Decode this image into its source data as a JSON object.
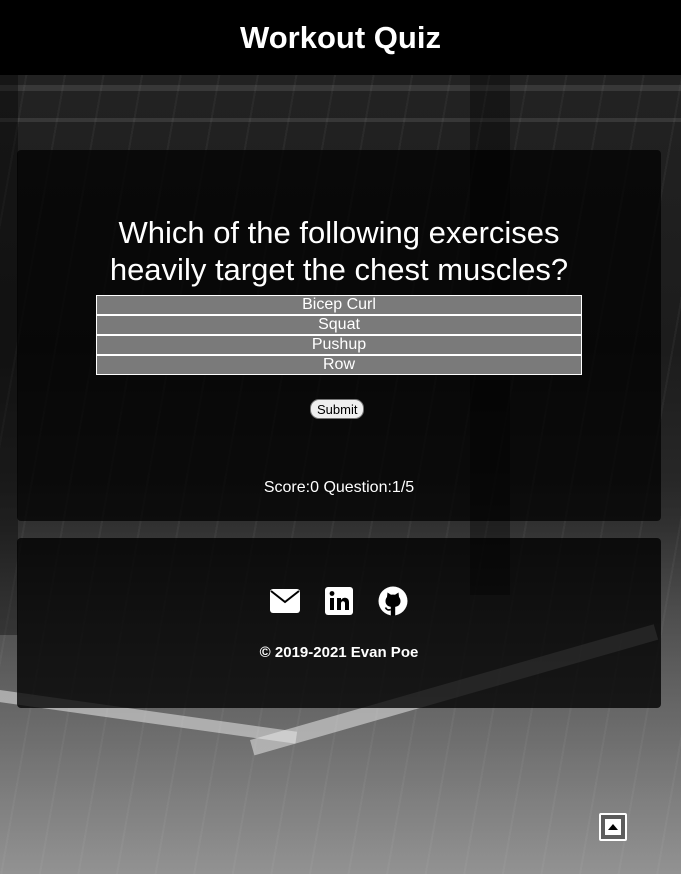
{
  "header": {
    "title": "Workout Quiz"
  },
  "quiz": {
    "question_line1": "Which of the following exercises",
    "question_line2": "heavily target the chest muscles?",
    "choices": [
      "Bicep Curl",
      "Squat",
      "Pushup",
      "Row"
    ],
    "submit_label": "Submit",
    "score_label": "Score:",
    "score": "0",
    "question_label": "Question:",
    "question_progress": "1/5"
  },
  "footer": {
    "social": [
      {
        "icon": "envelope-icon"
      },
      {
        "icon": "linkedin-icon"
      },
      {
        "icon": "github-icon"
      }
    ],
    "copyright": "© 2019-2021 Evan Poe"
  },
  "colors": {
    "header_bg": "#000000",
    "choice_bg": "#7a7a7a",
    "text": "#ffffff"
  },
  "scroll_top": {
    "icon": "arrow-up-square-icon"
  }
}
